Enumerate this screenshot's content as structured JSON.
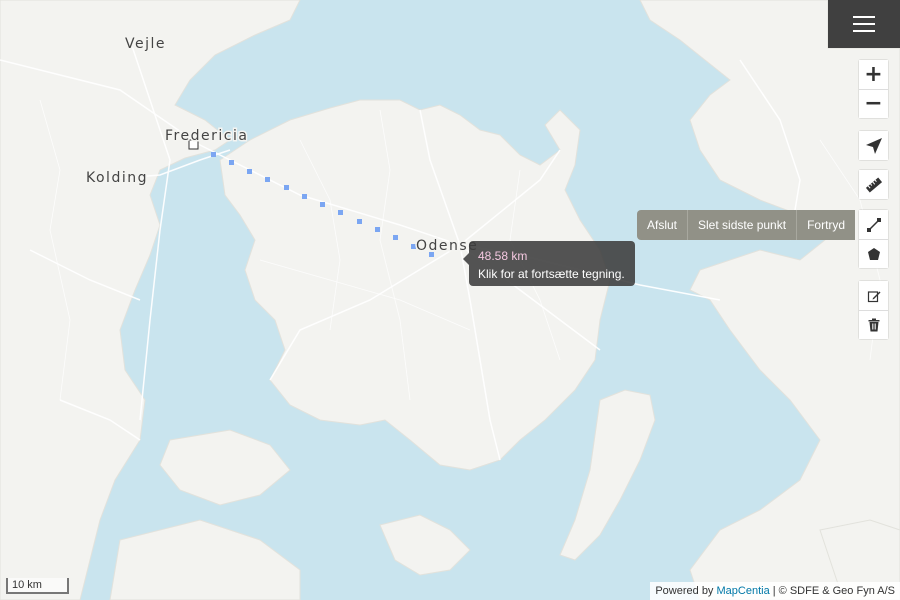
{
  "map": {
    "cities": [
      "Vejle",
      "Fredericia",
      "Kolding",
      "Odense"
    ],
    "colors": {
      "water": "#c9e4ee",
      "land": "#f3f3f0",
      "roads": "#ffffff",
      "measure_line": "#7ba6f2"
    }
  },
  "menu": {
    "icon": "hamburger-menu-icon"
  },
  "controls": {
    "zoom_in": "+",
    "zoom_out": "−",
    "locate_icon": "navigation-arrow-icon",
    "measure_icon": "ruler-icon",
    "draw_line_icon": "polyline-icon",
    "draw_polygon_icon": "polygon-icon",
    "edit_icon": "edit-icon",
    "delete_icon": "trash-icon"
  },
  "draw_actions": [
    "Afslut",
    "Slet sidste punkt",
    "Fortryd"
  ],
  "tooltip": {
    "distance": "48.58 km",
    "hint": "Klik for at fortsætte tegning."
  },
  "scale": {
    "label": "10 km"
  },
  "attribution": {
    "prefix": "Powered by",
    "link": "MapCentia",
    "suffix": "| © SDFE & Geo Fyn A/S"
  }
}
